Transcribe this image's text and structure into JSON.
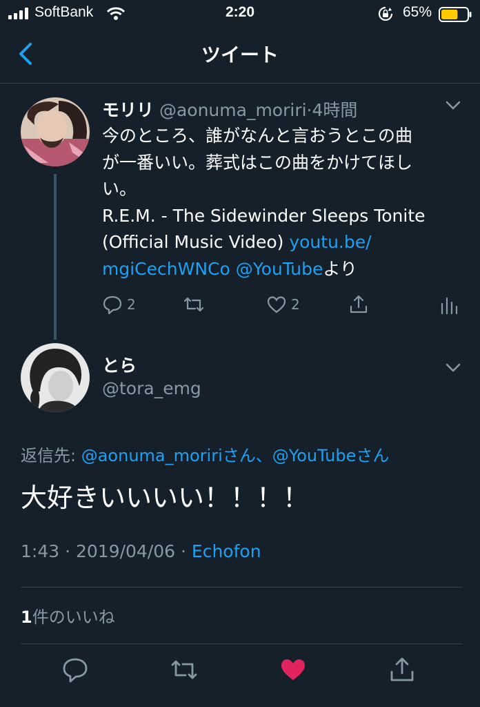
{
  "status_bar": {
    "carrier": "SoftBank",
    "time": "2:20",
    "battery_percent": "65%",
    "battery_level": 0.65
  },
  "nav": {
    "title": "ツイート",
    "back_icon": "chevron-left-icon"
  },
  "parent_tweet": {
    "name": "モリリ",
    "handle": "@aonuma_moriri",
    "separator": "·",
    "time_ago": "4時間",
    "lines": [
      "今のところ、誰がなんと言おうとこの曲",
      "が一番いい。葬式はこの曲をかけてほし",
      "い。",
      "R.E.M. - The Sidewinder Sleeps Tonite"
    ],
    "line5_text": "(Official Music Video) ",
    "link_part1": "youtu.be/",
    "link_part2": "mgiCechWNCo",
    "mention": "@YouTube",
    "suffix": "より",
    "reply_count": "2",
    "like_count": "2"
  },
  "tweet": {
    "name": "とら",
    "handle": "@tora_emg",
    "reply_label": "返信先: ",
    "reply_mention1": "@aonuma_moriri",
    "reply_san1": "さん、",
    "reply_mention2": "@YouTube",
    "reply_san2": "さん",
    "text": "大好きいいいい！！！！",
    "time": "1:43 · 2019/04/06 · ",
    "client": "Echofon",
    "like_count": "1",
    "like_label": "件のいいね"
  },
  "colors": {
    "background": "#15202b",
    "accent": "#1da1f2",
    "muted": "#8899a6",
    "like": "#e0245e",
    "battery": "#ffcc00"
  }
}
